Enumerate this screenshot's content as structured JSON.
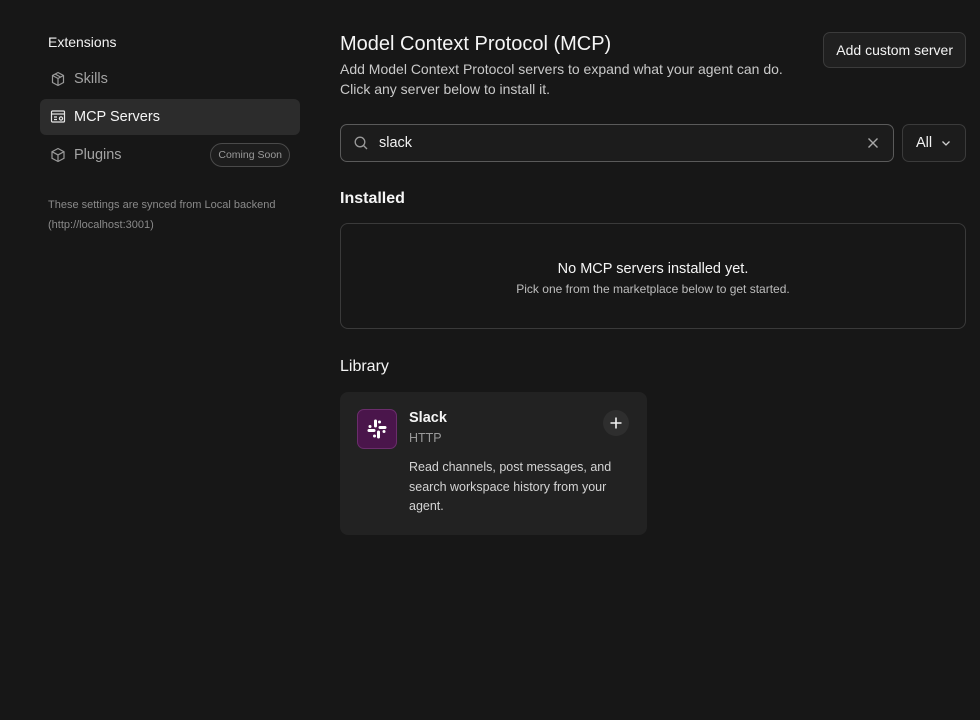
{
  "sidebar": {
    "title": "Extensions",
    "items": [
      {
        "label": "Skills",
        "icon": "cube-stack-icon"
      },
      {
        "label": "MCP Servers",
        "icon": "server-settings-icon"
      },
      {
        "label": "Plugins",
        "icon": "package-icon",
        "badge": "Coming Soon"
      }
    ],
    "sync_note": "These settings are synced from Local backend (http://localhost:3001)"
  },
  "main": {
    "title": "Model Context Protocol (MCP)",
    "description": "Add Model Context Protocol servers to expand what your agent can do. Click any server below to install it.",
    "add_button": "Add custom server",
    "search": {
      "value": "slack"
    },
    "filter": {
      "selected": "All"
    },
    "installed": {
      "title": "Installed",
      "empty_title": "No MCP servers installed yet.",
      "empty_subtitle": "Pick one from the marketplace below to get started."
    },
    "library": {
      "title": "Library",
      "cards": [
        {
          "name": "Slack",
          "type": "HTTP",
          "description": "Read channels, post messages, and search workspace history from your agent.",
          "icon": "slack-icon"
        }
      ]
    }
  },
  "colors": {
    "background": "#171717",
    "active_nav": "#2c2c2c",
    "card": "#222222",
    "slack_purple": "#4a154b"
  }
}
